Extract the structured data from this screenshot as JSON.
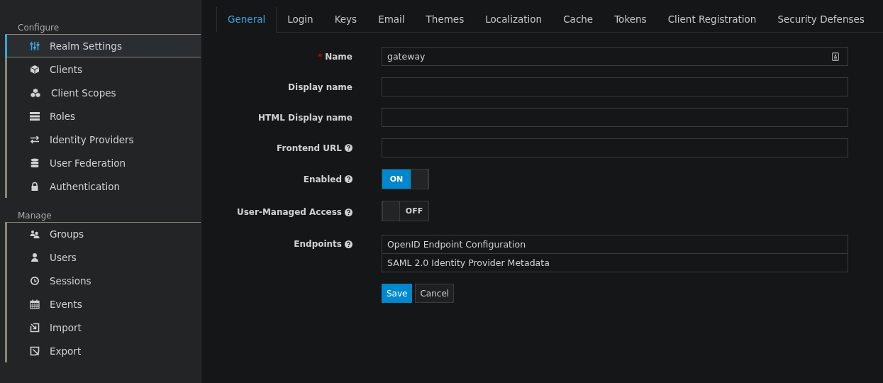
{
  "sidebar": {
    "sections": [
      {
        "title": "Configure",
        "items": [
          {
            "label": "Realm Settings",
            "selected": true
          },
          {
            "label": "Clients",
            "selected": false
          },
          {
            "label": "Client Scopes",
            "selected": false
          },
          {
            "label": "Roles",
            "selected": false
          },
          {
            "label": "Identity Providers",
            "selected": false
          },
          {
            "label": "User Federation",
            "selected": false
          },
          {
            "label": "Authentication",
            "selected": false
          }
        ]
      },
      {
        "title": "Manage",
        "items": [
          {
            "label": "Groups",
            "selected": false
          },
          {
            "label": "Users",
            "selected": false
          },
          {
            "label": "Sessions",
            "selected": false
          },
          {
            "label": "Events",
            "selected": false
          },
          {
            "label": "Import",
            "selected": false
          },
          {
            "label": "Export",
            "selected": false
          }
        ]
      }
    ]
  },
  "tabs": [
    {
      "label": "General",
      "selected": true
    },
    {
      "label": "Login",
      "selected": false
    },
    {
      "label": "Keys",
      "selected": false
    },
    {
      "label": "Email",
      "selected": false
    },
    {
      "label": "Themes",
      "selected": false
    },
    {
      "label": "Localization",
      "selected": false
    },
    {
      "label": "Cache",
      "selected": false
    },
    {
      "label": "Tokens",
      "selected": false
    },
    {
      "label": "Client Registration",
      "selected": false
    },
    {
      "label": "Security Defenses",
      "selected": false
    }
  ],
  "form": {
    "fields": [
      {
        "kind": "text",
        "label": "Name",
        "required_mark": "*",
        "help": false,
        "value": "gateway"
      },
      {
        "kind": "text",
        "label": "Display name",
        "help": false
      },
      {
        "kind": "text",
        "label": "HTML Display name",
        "help": false
      },
      {
        "kind": "text",
        "label": "Frontend URL",
        "help": true
      },
      {
        "kind": "toggle",
        "label": "Enabled",
        "help": true,
        "on": true,
        "on_text": "ON"
      },
      {
        "kind": "toggle",
        "label": "User-Managed Access",
        "help": true,
        "on": false,
        "off_text": "OFF"
      },
      {
        "kind": "links",
        "label": "Endpoints",
        "help": true,
        "links": [
          "OpenID Endpoint Configuration",
          "SAML 2.0 Identity Provider Metadata"
        ]
      }
    ],
    "buttons": [
      {
        "label": "Save",
        "primary": true
      },
      {
        "label": "Cancel",
        "primary": false
      }
    ]
  }
}
